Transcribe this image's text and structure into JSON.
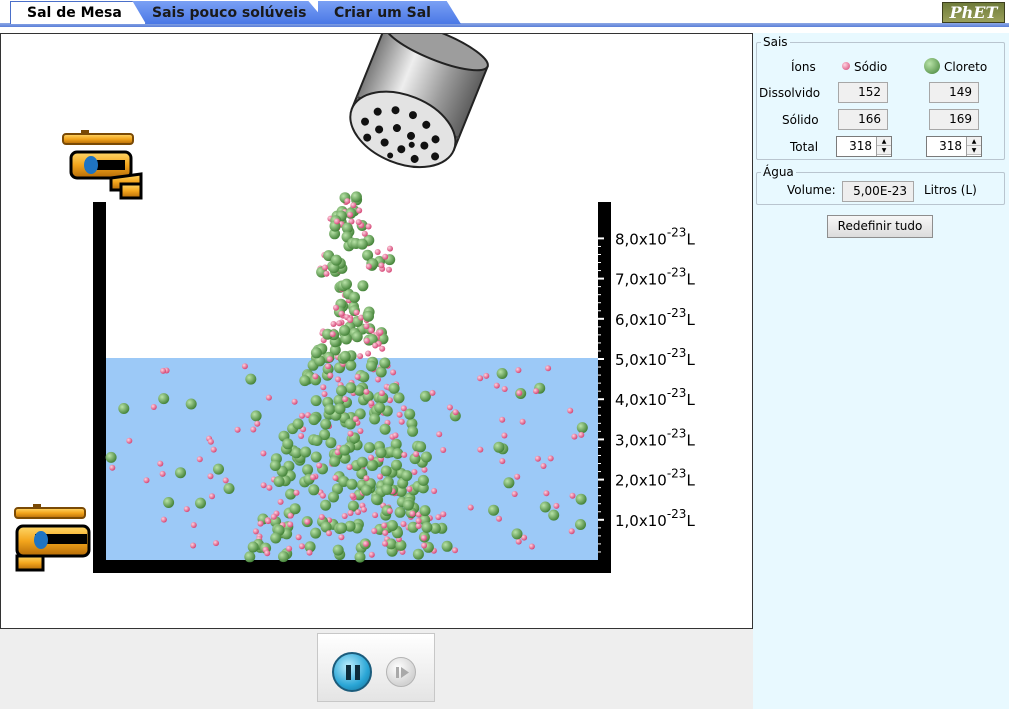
{
  "tabs": [
    {
      "label": "Sal de Mesa",
      "active": true
    },
    {
      "label": "Sais pouco solúveis",
      "active": false
    },
    {
      "label": "Criar um Sal",
      "active": false
    }
  ],
  "logo": "PhET",
  "scale": {
    "ticks": [
      {
        "value": 1,
        "text": "1,0x10",
        "exp": "-23",
        "unit": "L"
      },
      {
        "value": 2,
        "text": "2,0x10",
        "exp": "-23",
        "unit": "L"
      },
      {
        "value": 3,
        "text": "3,0x10",
        "exp": "-23",
        "unit": "L"
      },
      {
        "value": 4,
        "text": "4,0x10",
        "exp": "-23",
        "unit": "L"
      },
      {
        "value": 5,
        "text": "5,0x10",
        "exp": "-23",
        "unit": "L"
      },
      {
        "value": 6,
        "text": "6,0x10",
        "exp": "-23",
        "unit": "L"
      },
      {
        "value": 7,
        "text": "7,0x10",
        "exp": "-23",
        "unit": "L"
      },
      {
        "value": 8,
        "text": "8,0x10",
        "exp": "-23",
        "unit": "L"
      }
    ],
    "water_level": 5.0
  },
  "colors": {
    "water": "#9cc9f7",
    "sodium": "#e0648c",
    "chloride": "#5c9d4e",
    "panel_bg": "#e8f9ff"
  },
  "controls": {
    "pause_icon": "pause-icon",
    "step_icon": "step-icon"
  },
  "panel": {
    "sais_title": "Sais",
    "ions_label": "Íons",
    "sodium_label": "Sódio",
    "chloride_label": "Cloreto",
    "dissolved_label": "Dissolvido",
    "solid_label": "Sólido",
    "total_label": "Total",
    "sodium_dissolved": "152",
    "chloride_dissolved": "149",
    "sodium_solid": "166",
    "chloride_solid": "169",
    "sodium_total": "318",
    "chloride_total": "318",
    "water_title": "Água",
    "volume_label": "Volume:",
    "volume_value": "5,00E-23",
    "volume_unit": "Litros (L)",
    "reset_label": "Redefinir tudo"
  }
}
